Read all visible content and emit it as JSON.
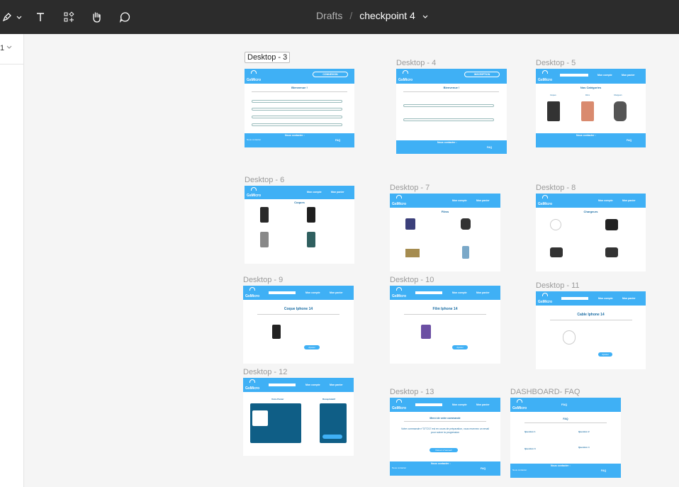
{
  "toolbar": {
    "icons": [
      "pen-icon",
      "chevron-down-icon",
      "text-icon",
      "components-icon",
      "hand-icon",
      "comment-icon"
    ]
  },
  "breadcrumb": {
    "drafts": "Drafts",
    "separator": "/",
    "file_name": "checkpoint 4"
  },
  "left_panel": {
    "page_number": "1"
  },
  "frames": {
    "d3": {
      "label": "Desktop - 3",
      "brand": "GsMicro",
      "button": "CONNEXION",
      "title": "Bienvenue !",
      "contact": "Nous contacter :",
      "left": "Nous contacter",
      "faq": "FAQ"
    },
    "d4": {
      "label": "Desktop - 4",
      "brand": "GsMicro",
      "button": "INSCRIPTION",
      "title": "Bienvenue !",
      "contact": "Nous contacter :",
      "faq": "FAQ"
    },
    "d5": {
      "label": "Desktop - 5",
      "brand": "GsMicro",
      "nav1": "Mon compte",
      "nav2": "Mon panier",
      "title": "Nos Catégories",
      "cat1": "Coques",
      "cat2": "Films",
      "cat3": "Chargeurs",
      "contact": "Nous contacter :",
      "faq": "FAQ"
    },
    "d6": {
      "label": "Desktop - 6",
      "brand": "GsMicro",
      "nav1": "Mon compte",
      "nav2": "Mon panier",
      "title": "Coques"
    },
    "d7": {
      "label": "Desktop - 7",
      "brand": "GsMicro",
      "nav1": "Mon compte",
      "nav2": "Mon panier",
      "title": "Films"
    },
    "d8": {
      "label": "Desktop - 8",
      "brand": "GsMicro",
      "nav1": "Mon compte",
      "nav2": "Mon panier",
      "title": "Chargeurs"
    },
    "d9": {
      "label": "Desktop - 9",
      "brand": "GsMicro",
      "nav1": "Mon compte",
      "nav2": "Mon panier",
      "title": "Coque Iphone 14",
      "button": "Ajouter"
    },
    "d10": {
      "label": "Desktop - 10",
      "brand": "GsMicro",
      "nav1": "Mon compte",
      "nav2": "Mon panier",
      "title": "Film Iphone 14",
      "button": "Ajouter"
    },
    "d11": {
      "label": "Desktop - 11",
      "brand": "GsMicro",
      "nav1": "Mon compte",
      "nav2": "Mon panier",
      "title": "Cable Iphone 14",
      "button": "Ajouter"
    },
    "d12": {
      "label": "Desktop - 12",
      "brand": "GsMicro",
      "nav1": "Mon compte",
      "nav2": "Mon panier",
      "title": "Votre Panier",
      "right_title": "Récapitulatif"
    },
    "d13": {
      "label": "Desktop - 13",
      "brand": "GsMicro",
      "nav1": "Mon compte",
      "nav2": "Mon panier",
      "title": "Merci de votre commande",
      "message": "Votre commande n°377217 est en cours de préparation, vous recevrez un email pour suivre la progression",
      "button": "Retour à l'accueil",
      "contact": "Nous contacter :",
      "left": "Nous contacter",
      "faq": "FAQ"
    },
    "faq": {
      "label": "DASHBOARD- FAQ",
      "brand": "GsMicro",
      "nav": "FAQ",
      "title": "FAQ",
      "q1": "Question 1",
      "q2": "Question 2",
      "q3": "Question 3",
      "q4": "Question 4",
      "contact": "Nous contacter :",
      "left": "Nous contacter",
      "faq": "FAQ"
    }
  },
  "colors": {
    "toolbar_bg": "#2c2c2c",
    "canvas_bg": "#f5f5f5",
    "accent": "#3fb0f5",
    "dark_panel": "#0f5e86"
  }
}
